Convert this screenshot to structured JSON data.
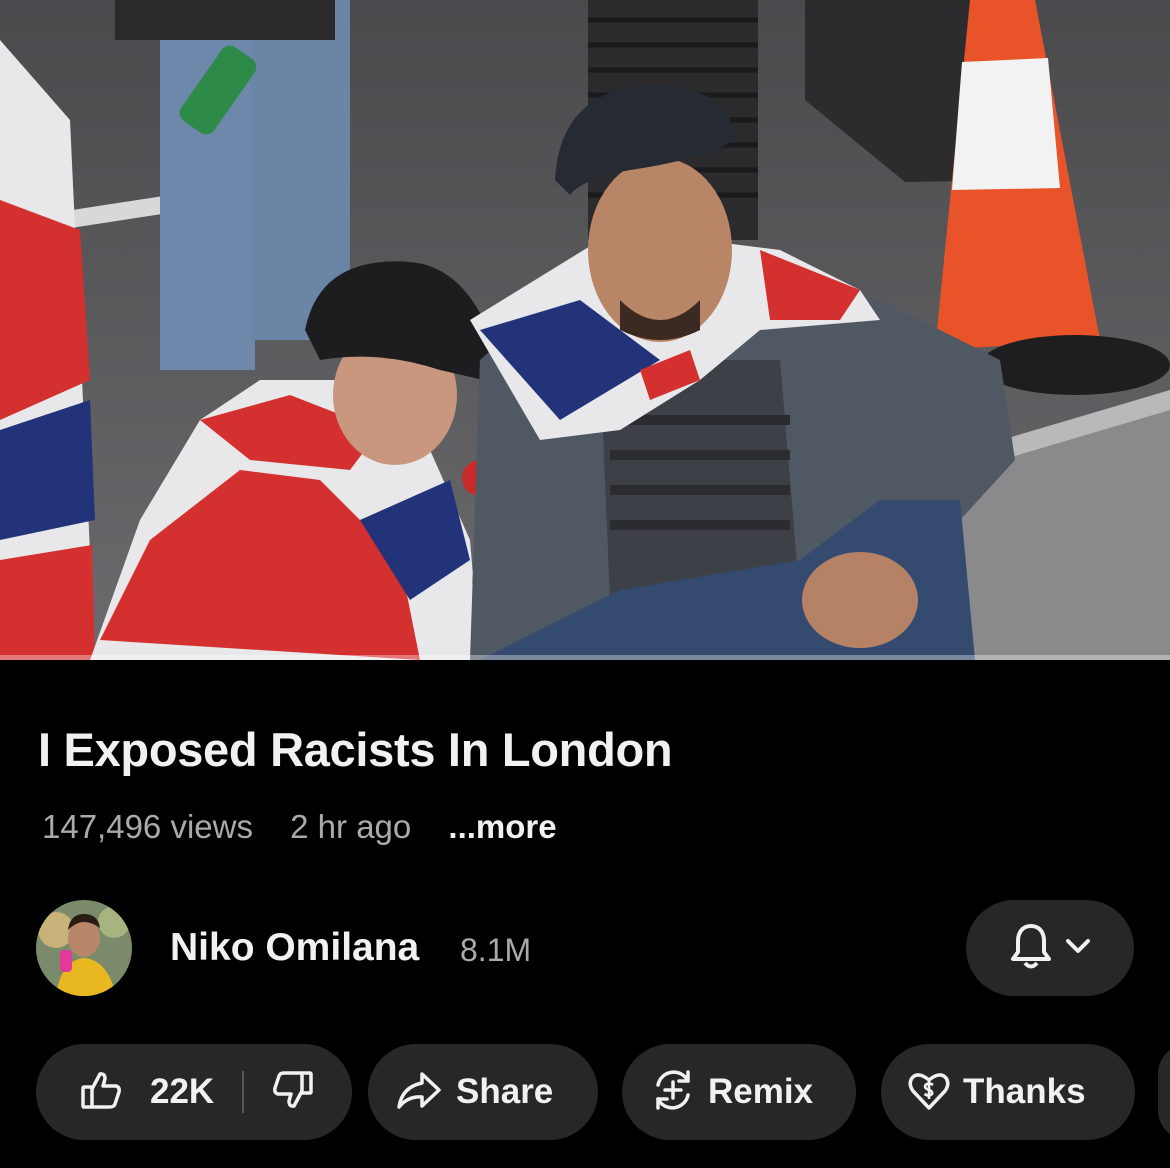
{
  "video": {
    "title": "I Exposed Racists In London",
    "views": "147,496 views",
    "age": "2 hr ago",
    "more_label": "...more",
    "progress": 0
  },
  "channel": {
    "name": "Niko Omilana",
    "subscribers": "8.1M"
  },
  "actions": {
    "likes": "22K",
    "share_label": "Share",
    "remix_label": "Remix",
    "thanks_label": "Thanks"
  },
  "colors": {
    "background": "#000000",
    "pill": "#272727",
    "text_primary": "#f1f1f1",
    "text_secondary": "#aaaaaa"
  },
  "icons": [
    "like-icon",
    "dislike-icon",
    "share-icon",
    "remix-icon",
    "thanks-icon",
    "bell-icon",
    "chevron-down-icon"
  ]
}
